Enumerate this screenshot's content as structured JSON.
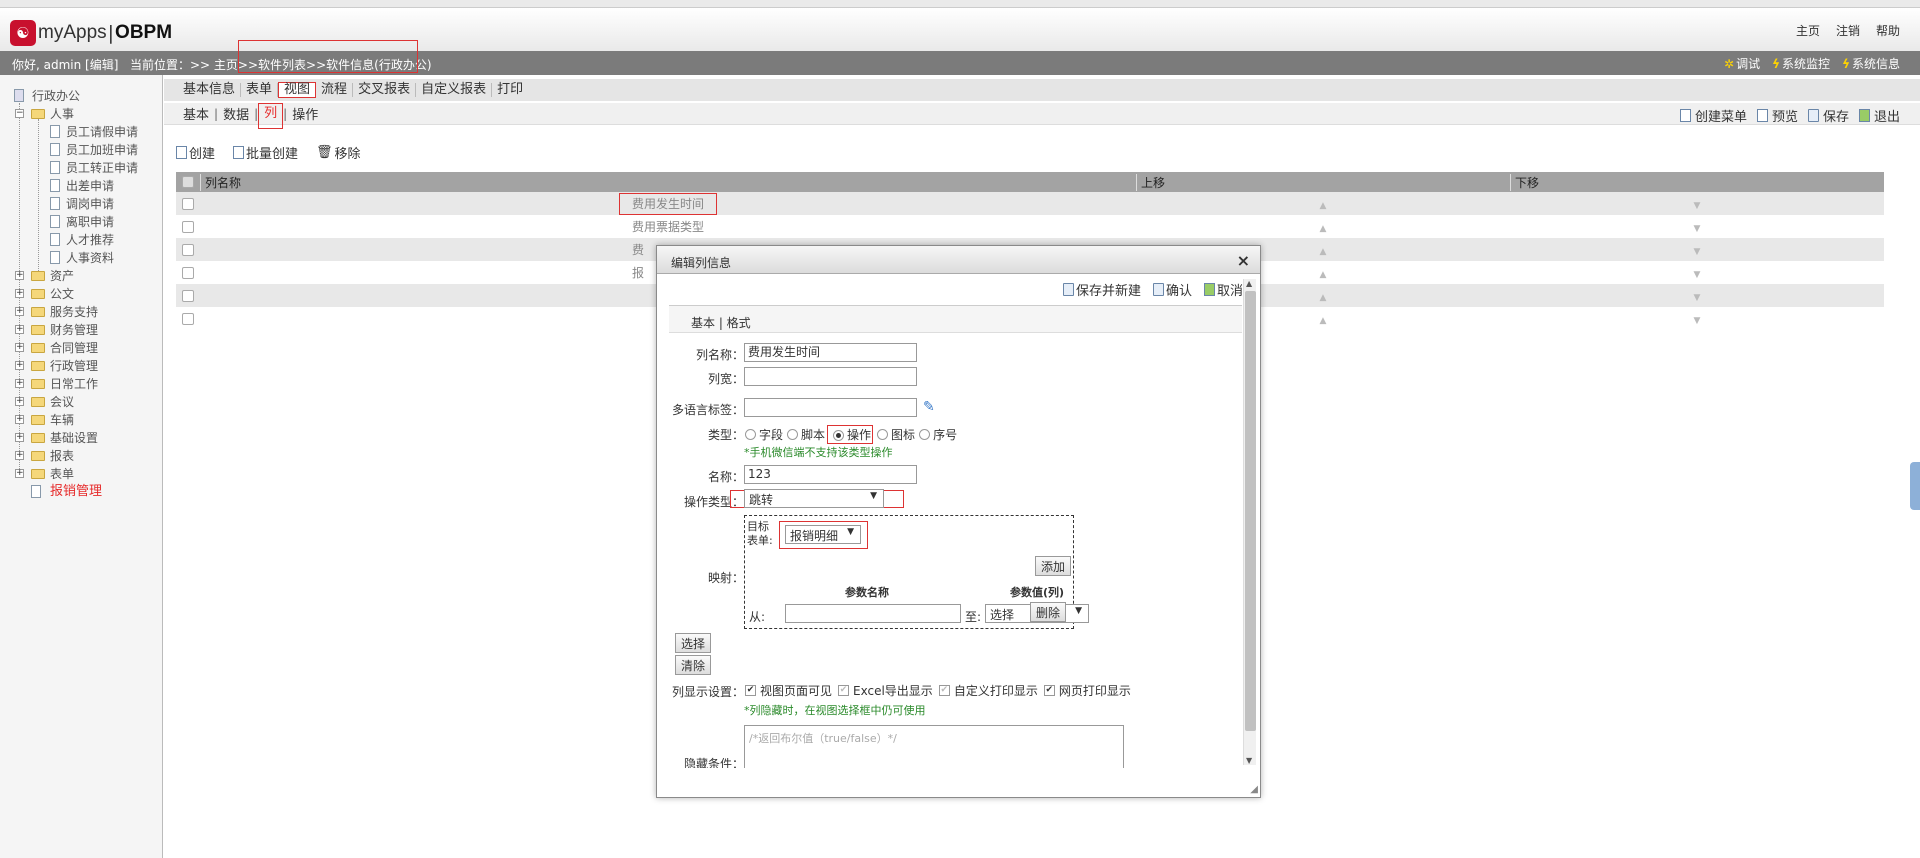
{
  "header": {
    "app_name": "myApps",
    "separator": "|",
    "product": "OBPM",
    "links": [
      "主页",
      "注销",
      "帮助"
    ]
  },
  "subbar": {
    "user": "你好, admin [编辑]",
    "breadcrumb": "当前位置：>> 主页>>软件列表>>软件信息(行政办公)",
    "sys_links": [
      "调试",
      "系统监控",
      "系统信息"
    ]
  },
  "sidebar": {
    "root": "行政办公",
    "hr": "人事",
    "hr_items": [
      "员工请假申请",
      "员工加班申请",
      "员工转正申请",
      "出差申请",
      "调岗申请",
      "离职申请",
      "人才推荐",
      "人事资料"
    ],
    "folders": [
      "资产",
      "公文",
      "服务支持",
      "财务管理",
      "合同管理",
      "行政管理",
      "日常工作",
      "会议",
      "车辆",
      "基础设置",
      "报表",
      "表单"
    ],
    "active": "报销管理"
  },
  "tabs1": [
    "基本信息",
    "表单",
    "视图",
    "流程",
    "交叉报表",
    "自定义报表",
    "打印"
  ],
  "tabs1_active": "视图",
  "tabs2": [
    "基本",
    "数据",
    "列",
    "操作"
  ],
  "tabs2_active": "列",
  "toolbar_right": [
    "创建菜单",
    "预览",
    "保存",
    "退出"
  ],
  "list_actions": [
    "创建",
    "批量创建",
    "移除"
  ],
  "grid": {
    "headers": [
      "列名称",
      "上移",
      "下移"
    ],
    "rows": [
      "费用发生时间",
      "费用票据类型",
      "费",
      "报",
      "",
      ""
    ]
  },
  "modal": {
    "title": "编辑列信息",
    "close": "×",
    "top_actions": [
      "保存并新建",
      "确认",
      "取消"
    ],
    "tabs": "基本 | 格式",
    "labels": {
      "name": "列名称：",
      "width": "列宽：",
      "i18n": "多语言标签：",
      "type": "类型：",
      "title": "名称：",
      "op_type": "操作类型：",
      "mapping": "映射：",
      "display": "列显示设置：",
      "hide": "隐藏条件："
    },
    "values": {
      "name": "费用发生时间",
      "width": "",
      "i18n": "",
      "title": "123",
      "op_type": "跳转",
      "target_form": "报销明细"
    },
    "type_options": [
      "字段",
      "脚本",
      "操作",
      "图标",
      "序号"
    ],
    "type_selected": "操作",
    "type_note": "*手机微信端不支持该类型操作",
    "target_label_1": "目标",
    "target_label_2": "表单:",
    "add_btn": "添加",
    "param_name_hdr": "参数名称",
    "param_value_hdr": "参数值(列)",
    "from_label": "从:",
    "to_label": "至:",
    "to_select": "选择",
    "delete_btn": "删除",
    "select_btn": "选择",
    "clear_btn": "清除",
    "display_opts": [
      "视图页面可见",
      "Excel导出显示",
      "自定义打印显示",
      "网页打印显示"
    ],
    "display_note": "*列隐藏时，在视图选择框中仍可使用",
    "hide_placeholder": "/*返回布尔值（true/false）*/"
  },
  "colors": {
    "accent_red": "#d33333",
    "header_gray": "#7b7b7b",
    "note_green": "#2a8a2a"
  }
}
